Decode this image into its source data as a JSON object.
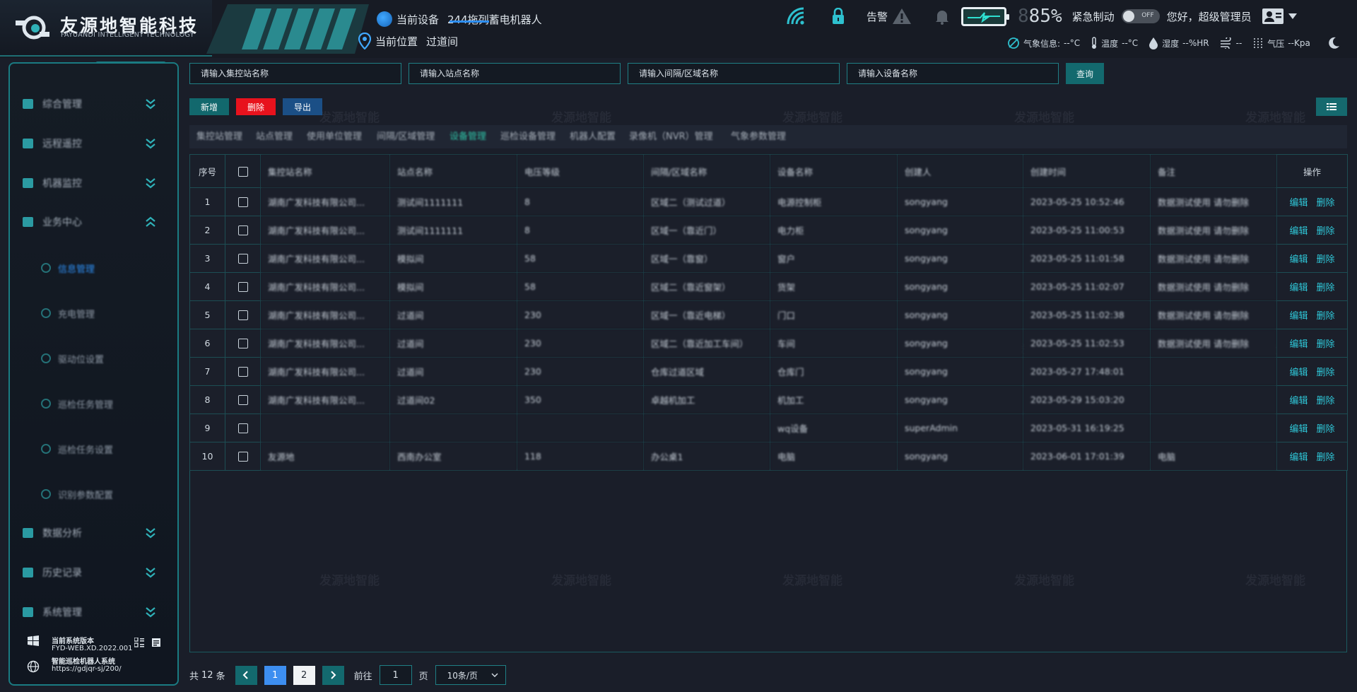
{
  "header": {
    "brand_name": "友源地智能科技",
    "brand_sub": "FAYUANDI INTELLIGENT TECHNOLOGY",
    "device_label": "当前设备",
    "device_value": "244拖列蓄电机器人",
    "location_label": "当前位置",
    "location_value": "过道间",
    "alarm_label": "告警",
    "battery_percent": "85%",
    "battery_digit": "8",
    "emergency_label": "紧急制动",
    "toggle_text": "OFF",
    "greeting": "您好，",
    "user_name": "超级管理员",
    "weather": {
      "weather_label": "气象信息:",
      "weather_value": "--°C",
      "temp_label": "温度",
      "temp_value": "--°C",
      "humidity_label": "湿度",
      "humidity_value": "--%HR",
      "wind_value": "--",
      "pressure_label": "气压",
      "pressure_value": "--Kpa"
    }
  },
  "sidebar": {
    "items": [
      {
        "label": "综合管理"
      },
      {
        "label": "远程遥控"
      },
      {
        "label": "机器监控"
      },
      {
        "label": "业务中心"
      },
      {
        "label": "数据分析"
      },
      {
        "label": "历史记录"
      },
      {
        "label": "系统管理"
      }
    ],
    "sub_items": [
      {
        "label": "信息管理"
      },
      {
        "label": "充电管理"
      },
      {
        "label": "驱动位设置"
      },
      {
        "label": "巡检任务管理"
      },
      {
        "label": "巡检任务设置"
      },
      {
        "label": "识别参数配置"
      }
    ],
    "version_title": "当前系统版本",
    "version_value": "FYD-WEB.XD.2022.001",
    "system_name": "智能巡检机器人系统",
    "system_url": "https://gdjqr-sj/200/"
  },
  "filters": {
    "station_placeholder": "请输入集控站名称",
    "site_placeholder": "请输入站点名称",
    "area_placeholder": "请输入间隔/区域名称",
    "device_placeholder": "请输入设备名称",
    "query_label": "查询"
  },
  "toolbar": {
    "add_label": "新增",
    "delete_label": "删除",
    "export_label": "导出"
  },
  "tabs": [
    {
      "label": "集控站管理"
    },
    {
      "label": "站点管理"
    },
    {
      "label": "使用单位管理"
    },
    {
      "label": "间隔/区域管理"
    },
    {
      "label": "设备管理"
    },
    {
      "label": "巡检设备管理"
    },
    {
      "label": "机器人配置"
    },
    {
      "label": "录像机（NVR）管理"
    },
    {
      "label": "气象参数管理"
    }
  ],
  "table": {
    "headers": [
      "序号",
      "",
      "集控站名称",
      "站点名称",
      "电压等级",
      "间隔/区域名称",
      "设备名称",
      "创建人",
      "创建时间",
      "备注",
      "操作"
    ],
    "edit_label": "编辑",
    "delete_label": "删除",
    "rows": [
      {
        "no": "1",
        "station": "湖南广发科技有限公司...",
        "site": "测试间1111111",
        "voltage": "8",
        "area": "区域二（测试过道）",
        "device": "电源控制柜",
        "creator": "songyang",
        "created": "2023-05-25 10:52:46",
        "remark": "数据测试使用 请勿删除"
      },
      {
        "no": "2",
        "station": "湖南广发科技有限公司...",
        "site": "测试间1111111",
        "voltage": "8",
        "area": "区域一（靠近门）",
        "device": "电力柜",
        "creator": "songyang",
        "created": "2023-05-25 11:00:53",
        "remark": "数据测试使用 请勿删除"
      },
      {
        "no": "3",
        "station": "湖南广发科技有限公司...",
        "site": "模拟间",
        "voltage": "58",
        "area": "区域一（靠窗）",
        "device": "窗户",
        "creator": "songyang",
        "created": "2023-05-25 11:01:58",
        "remark": "数据测试使用 请勿删除"
      },
      {
        "no": "4",
        "station": "湖南广发科技有限公司...",
        "site": "模拟间",
        "voltage": "58",
        "area": "区域二（靠近窗架）",
        "device": "货架",
        "creator": "songyang",
        "created": "2023-05-25 11:02:07",
        "remark": "数据测试使用 请勿删除"
      },
      {
        "no": "5",
        "station": "湖南广发科技有限公司...",
        "site": "过道间",
        "voltage": "230",
        "area": "区域一（靠近电梯）",
        "device": "门口",
        "creator": "songyang",
        "created": "2023-05-25 11:02:38",
        "remark": "数据测试使用 请勿删除"
      },
      {
        "no": "6",
        "station": "湖南广发科技有限公司...",
        "site": "过道间",
        "voltage": "230",
        "area": "区域二（靠近加工车间）",
        "device": "车间",
        "creator": "songyang",
        "created": "2023-05-25 11:02:53",
        "remark": "数据测试使用 请勿删除"
      },
      {
        "no": "7",
        "station": "湖南广发科技有限公司...",
        "site": "过道间",
        "voltage": "230",
        "area": "仓库过道区域",
        "device": "仓库门",
        "creator": "songyang",
        "created": "2023-05-27 17:48:01",
        "remark": ""
      },
      {
        "no": "8",
        "station": "湖南广发科技有限公司...",
        "site": "过道间02",
        "voltage": "350",
        "area": "卓越机加工",
        "device": "机加工",
        "creator": "songyang",
        "created": "2023-05-29 15:03:20",
        "remark": ""
      },
      {
        "no": "9",
        "station": "",
        "site": "",
        "voltage": "",
        "area": "",
        "device": "wq设备",
        "creator": "superAdmin",
        "created": "2023-05-31 16:19:25",
        "remark": ""
      },
      {
        "no": "10",
        "station": "友源地",
        "site": "西南办公室",
        "voltage": "118",
        "area": "办公桌1",
        "device": "电脑",
        "creator": "songyang",
        "created": "2023-06-01 17:01:39",
        "remark": "电脑"
      }
    ]
  },
  "pagination": {
    "total_prefix": "共",
    "total": "12",
    "total_suffix": "条",
    "pages": [
      "1",
      "2"
    ],
    "goto_label": "前往",
    "goto_value": "1",
    "page_unit": "页",
    "page_size": "10条/页"
  },
  "watermark": "发源地智能",
  "colors": {
    "accent": "#1a7b82",
    "link": "#2fc7d8",
    "danger": "#e8121d",
    "primary": "#3d8ef0",
    "active_tab": "#2fc3a7"
  }
}
